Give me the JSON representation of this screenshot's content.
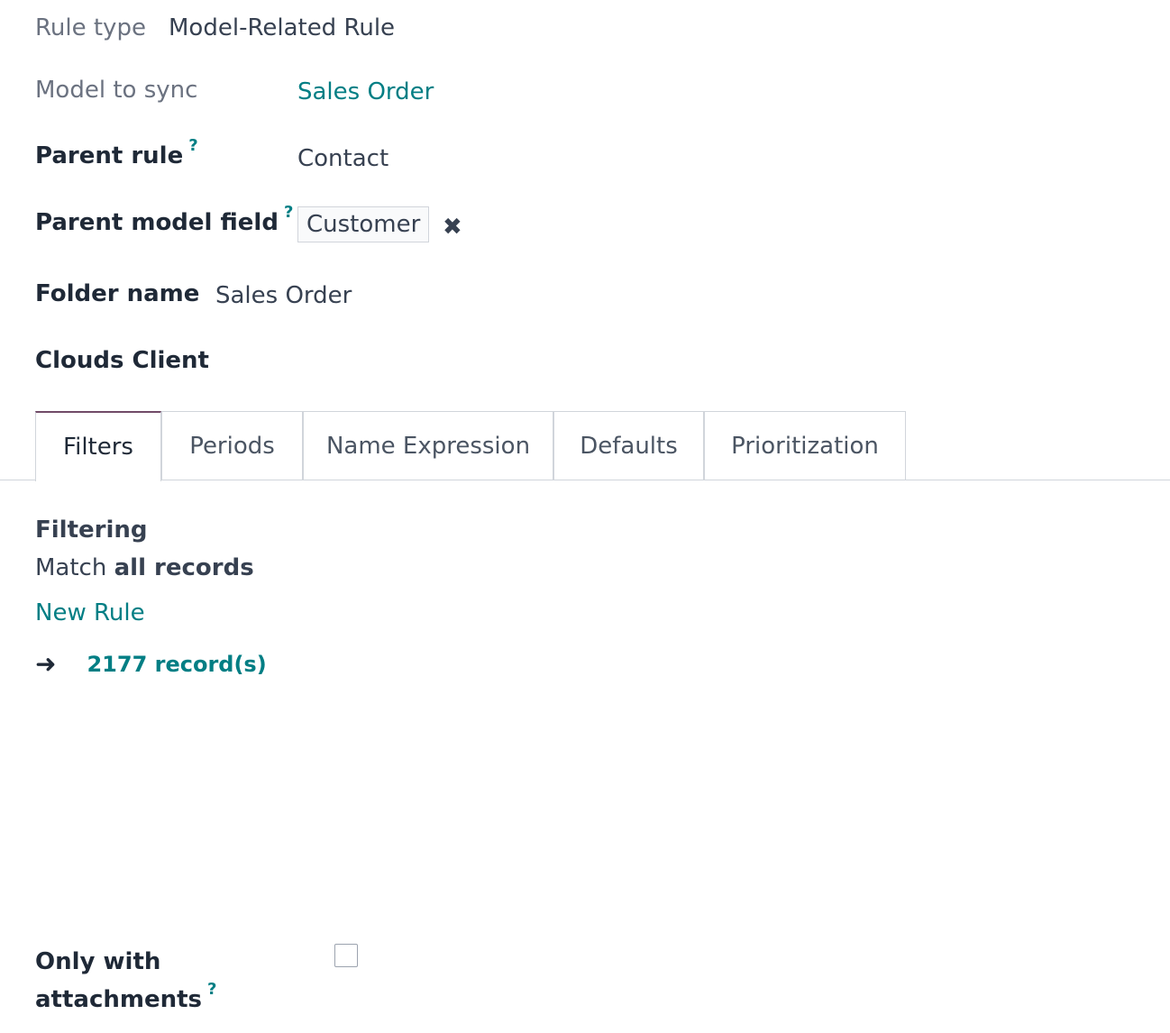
{
  "form": {
    "rule_type_label": "Rule type",
    "rule_type_value": "Model-Related Rule",
    "model_label": "Model to sync",
    "model_value": "Sales Order",
    "parent_rule_label": "Parent rule",
    "parent_rule_value": "Contact",
    "parent_field_label": "Parent model field",
    "parent_field_tag": "Customer",
    "folder_name_label": "Folder name",
    "folder_name_value": "Sales Order",
    "clouds_client_label": "Clouds Client",
    "help_mark": "?",
    "tag_remove_glyph": "✖"
  },
  "tabs": [
    {
      "label": "Filters",
      "active": true
    },
    {
      "label": "Periods",
      "active": false
    },
    {
      "label": "Name Expression",
      "active": false
    },
    {
      "label": "Defaults",
      "active": false
    },
    {
      "label": "Prioritization",
      "active": false
    }
  ],
  "filters": {
    "heading": "Filtering",
    "match_prefix": "Match",
    "match_scope": "all records",
    "new_rule_link": "New Rule",
    "arrow_glyph": "➜",
    "record_count": "2177 record(s)"
  },
  "attachments": {
    "label_line1": "Only with",
    "label_line2": "attachments",
    "checked": false
  },
  "colors": {
    "accent": "#017e84",
    "tab_active_border": "#714b67",
    "border": "#d1d5db"
  }
}
